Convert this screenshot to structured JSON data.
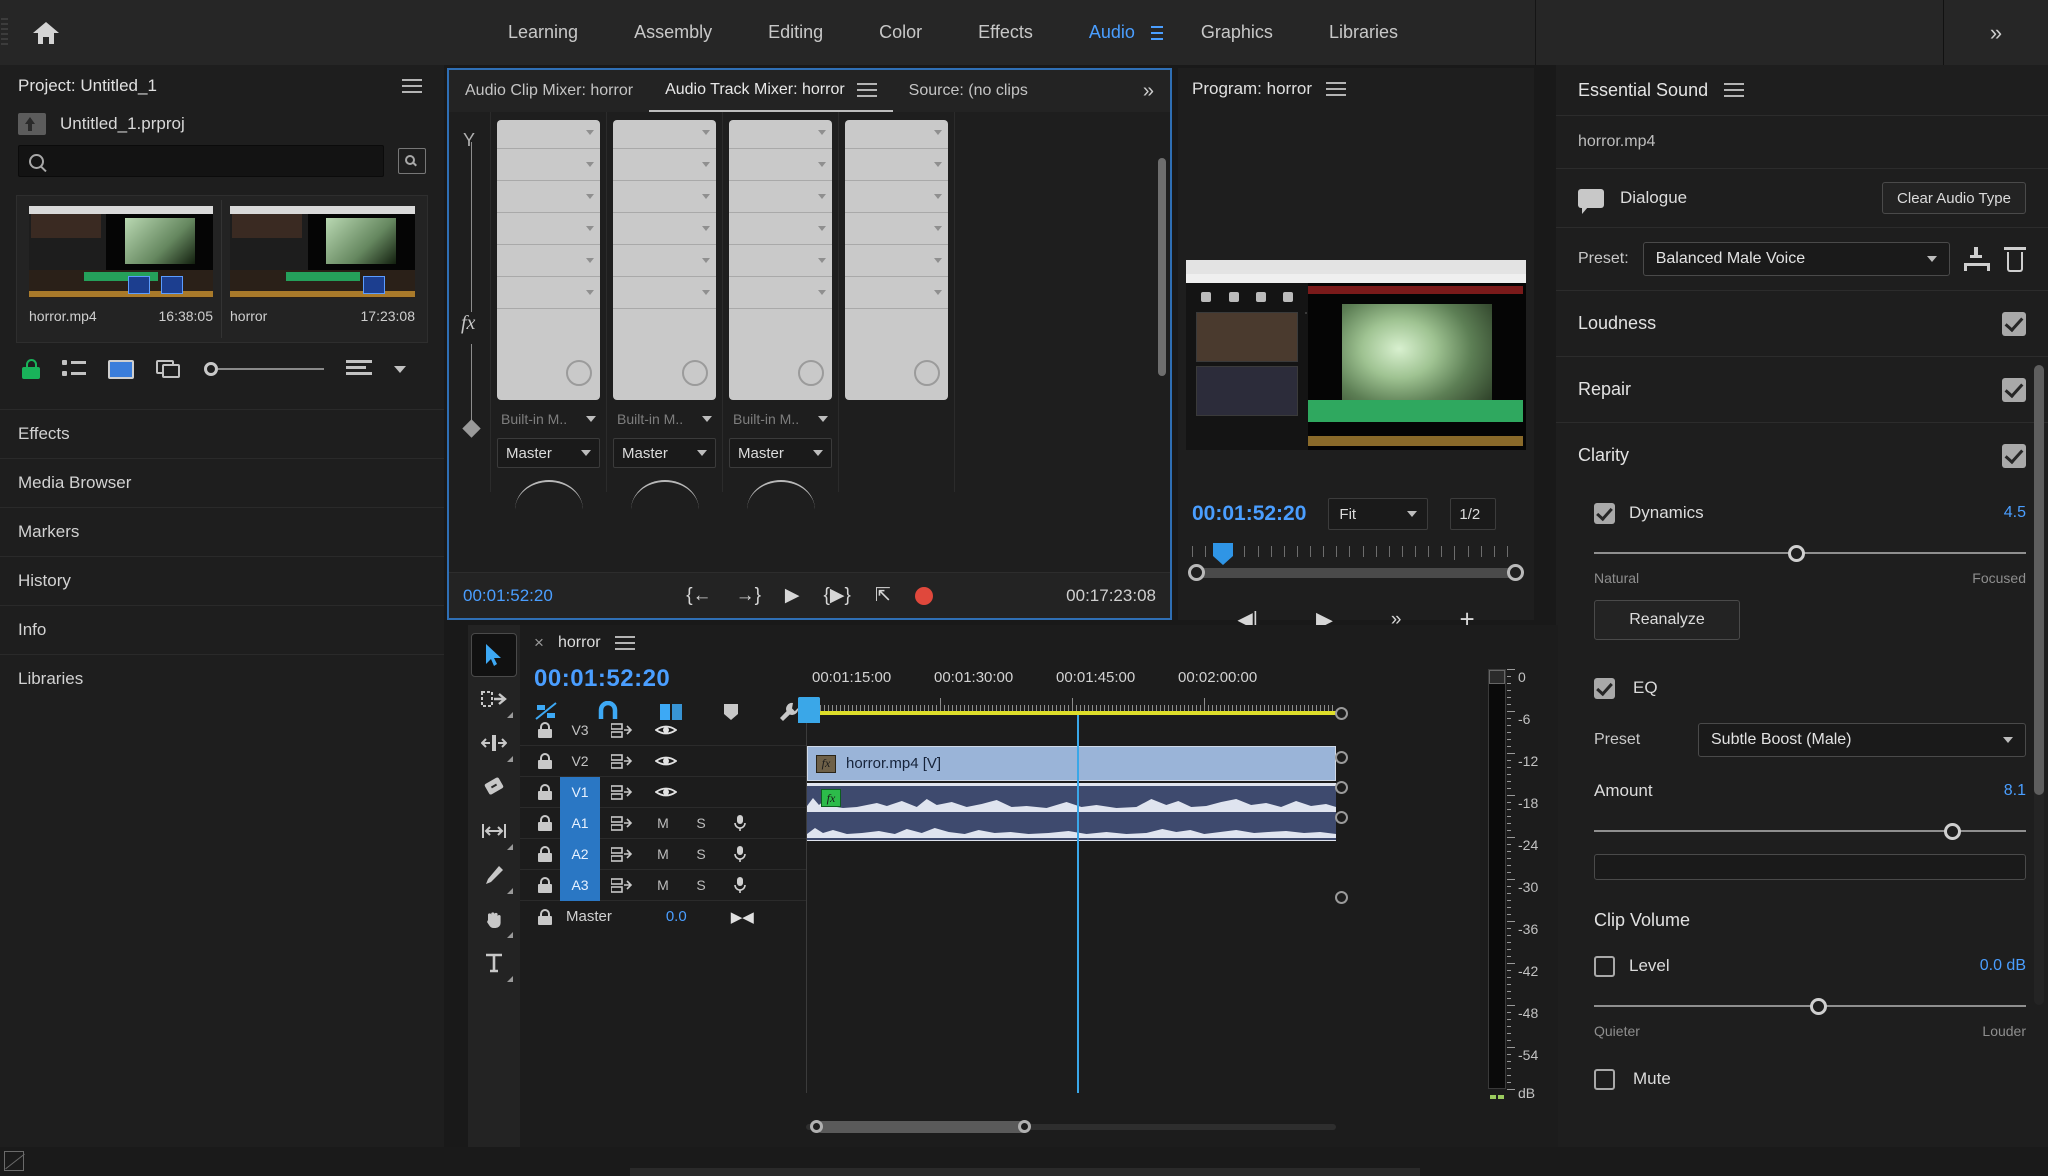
{
  "topbar": {
    "home_icon": "home-icon",
    "workspaces": [
      {
        "label": "Learning",
        "active": false
      },
      {
        "label": "Assembly",
        "active": false
      },
      {
        "label": "Editing",
        "active": false
      },
      {
        "label": "Color",
        "active": false
      },
      {
        "label": "Effects",
        "active": false
      },
      {
        "label": "Audio",
        "active": true
      },
      {
        "label": "Graphics",
        "active": false
      },
      {
        "label": "Libraries",
        "active": false
      }
    ],
    "overflow_label": "»"
  },
  "project": {
    "title": "Project: Untitled_1",
    "file_name": "Untitled_1.prproj",
    "search_placeholder": "",
    "search_value": "",
    "items": [
      {
        "name": "horror.mp4",
        "duration": "16:38:05"
      },
      {
        "name": "horror",
        "duration": "17:23:08"
      }
    ]
  },
  "panel_list": [
    {
      "label": "Effects"
    },
    {
      "label": "Media Browser"
    },
    {
      "label": "Markers"
    },
    {
      "label": "History"
    },
    {
      "label": "Info"
    },
    {
      "label": "Libraries"
    }
  ],
  "mixer": {
    "tabs": [
      {
        "label": "Audio Clip Mixer: horror",
        "active": false
      },
      {
        "label": "Audio Track Mixer: horror",
        "active": true
      },
      {
        "label": "Source: (no clips",
        "active": false
      }
    ],
    "overflow_label": "»",
    "side_labels": {
      "y": "Y",
      "fx": "fx"
    },
    "channels": [
      {
        "input": "Built-in M..",
        "output": "Master"
      },
      {
        "input": "Built-in M..",
        "output": "Master"
      },
      {
        "input": "Built-in M..",
        "output": "Master"
      },
      {
        "input": "",
        "output": ""
      }
    ],
    "timecode_current": "00:01:52:20",
    "timecode_total": "00:17:23:08",
    "transport": [
      "go-to-in-icon",
      "go-to-out-icon",
      "play-icon",
      "loop-icon",
      "export-icon",
      "record-icon"
    ]
  },
  "program": {
    "title": "Program: horror",
    "timecode": "00:01:52:20",
    "fit_value": "Fit",
    "ratio_value": "1/2",
    "buttons": [
      "step-back-icon",
      "play-icon",
      "more-icon",
      "add-button-icon"
    ]
  },
  "essential_sound": {
    "title": "Essential Sound",
    "file_name": "horror.mp4",
    "audio_type": "Dialogue",
    "clear_button": "Clear Audio Type",
    "preset_label": "Preset:",
    "preset_value": "Balanced Male Voice",
    "sections": {
      "loudness": {
        "label": "Loudness",
        "checked": true
      },
      "repair": {
        "label": "Repair",
        "checked": true
      },
      "clarity": {
        "label": "Clarity",
        "checked": true
      }
    },
    "dynamics": {
      "label": "Dynamics",
      "checked": true,
      "value": "4.5",
      "min_label": "Natural",
      "max_label": "Focused",
      "slider_percent": 45
    },
    "reanalyze_button": "Reanalyze",
    "eq": {
      "label": "EQ",
      "checked": true,
      "preset_label": "Preset",
      "preset_value": "Subtle Boost (Male)",
      "amount_label": "Amount",
      "amount_value": "8.1",
      "amount_percent": 81
    },
    "clip_volume": {
      "heading": "Clip Volume",
      "level_label": "Level",
      "level_checked": false,
      "level_value": "0.0 dB",
      "level_percent": 50,
      "min_label": "Quieter",
      "max_label": "Louder",
      "mute_label": "Mute",
      "mute_checked": false
    }
  },
  "timeline": {
    "sequence_name": "horror",
    "timecode": "00:01:52:20",
    "tools": [
      "selection-tool-icon",
      "track-select-forward-tool-icon",
      "ripple-edit-tool-icon",
      "razor-tool-icon",
      "slip-tool-icon",
      "pen-tool-icon",
      "hand-tool-icon",
      "type-tool-icon"
    ],
    "toggles": [
      "nested-sequence-icon",
      "snap-icon",
      "linked-selection-icon",
      "marker-icon",
      "settings-wrench-icon"
    ],
    "ruler_labels": [
      "00:01:15:00",
      "00:01:30:00",
      "00:01:45:00",
      "00:02:00:00"
    ],
    "tracks": [
      {
        "name": "V3",
        "type": "video",
        "targeted": false,
        "mute": "",
        "solo": "",
        "mic": false
      },
      {
        "name": "V2",
        "type": "video",
        "targeted": false,
        "mute": "",
        "solo": "",
        "mic": false
      },
      {
        "name": "V1",
        "type": "video",
        "targeted": true,
        "mute": "",
        "solo": "",
        "mic": false
      },
      {
        "name": "A1",
        "type": "audio",
        "targeted": true,
        "mute": "M",
        "solo": "S",
        "mic": true
      },
      {
        "name": "A2",
        "type": "audio",
        "targeted": true,
        "mute": "M",
        "solo": "S",
        "mic": true
      },
      {
        "name": "A3",
        "type": "audio",
        "targeted": true,
        "mute": "M",
        "solo": "S",
        "mic": true
      }
    ],
    "master": {
      "label": "Master",
      "value": "0.0"
    },
    "clip_video_label": "horror.mp4 [V]"
  },
  "meter": {
    "labels": [
      "0",
      "-6",
      "-12",
      "-18",
      "-24",
      "-30",
      "-36",
      "-42",
      "-48",
      "-54",
      "dB"
    ]
  },
  "colors": {
    "accent_blue": "#4a9eff",
    "panel_bg": "#1e1e1e",
    "app_bg": "#191919",
    "selected_track": "#2a77c4",
    "record_red": "#e0483c",
    "ruler_yellow": "#dede2a",
    "clip_video": "#9ab4d8",
    "clip_audio": "#3e4a6e"
  }
}
